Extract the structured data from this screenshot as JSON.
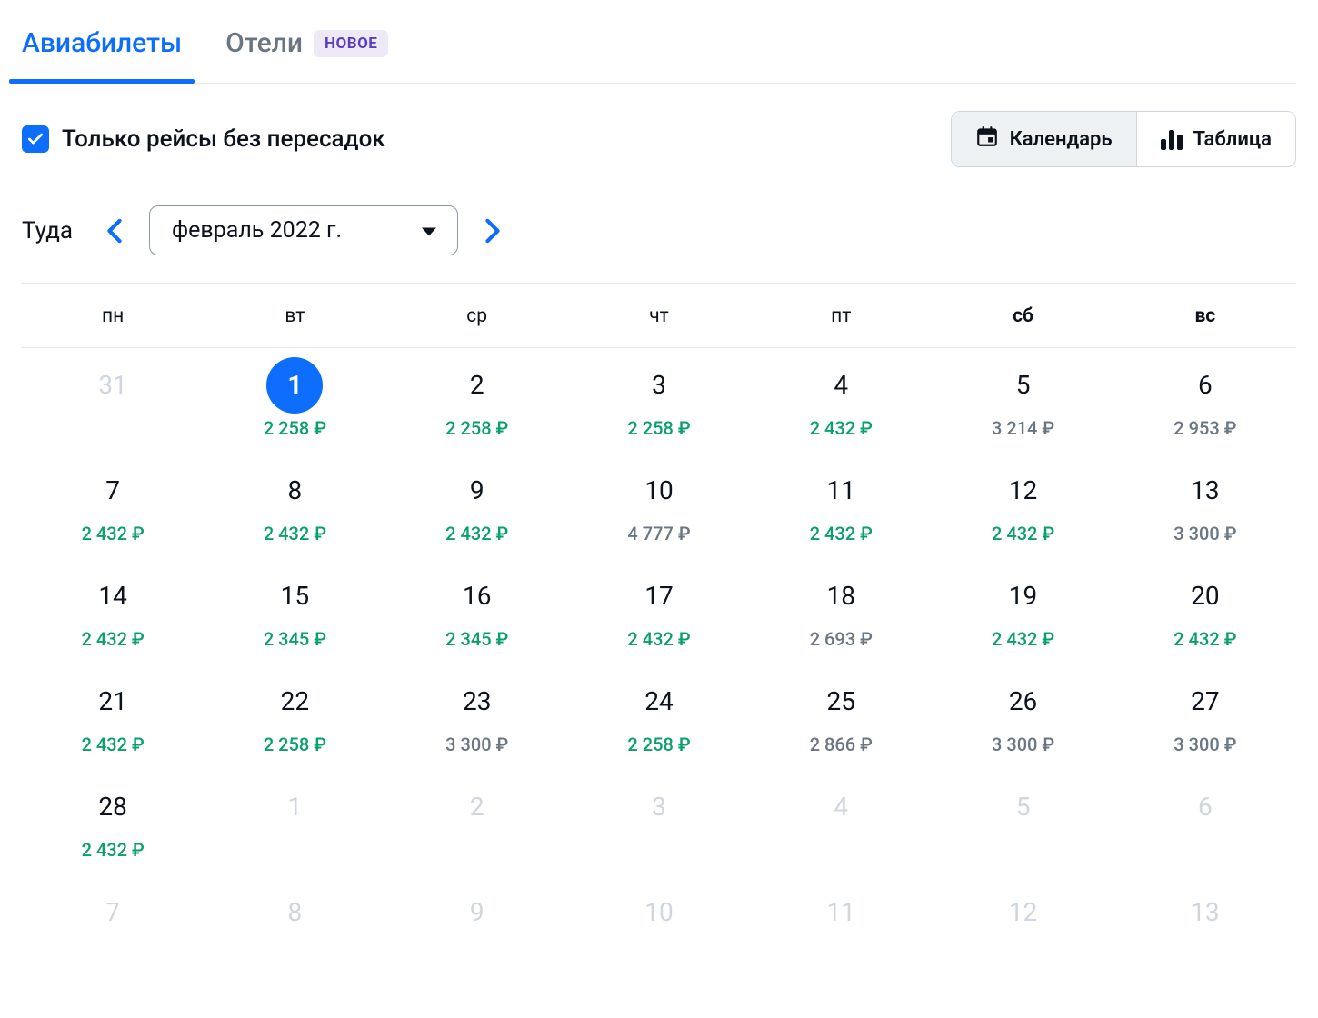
{
  "tabs": {
    "flights": "Авиабилеты",
    "hotels": "Отели",
    "badge": "НОВОЕ"
  },
  "filter": {
    "direct_only_label": "Только рейсы без пересадок"
  },
  "view": {
    "calendar": "Календарь",
    "table": "Таблица"
  },
  "nav": {
    "direction_label": "Туда",
    "month_label": "февраль 2022 г."
  },
  "dow": [
    "пн",
    "вт",
    "ср",
    "чт",
    "пт",
    "сб",
    "вс"
  ],
  "currency": "₽",
  "cells": [
    {
      "day": "31",
      "out": true
    },
    {
      "day": "1",
      "price": "2 258",
      "color": "green",
      "selected": true
    },
    {
      "day": "2",
      "price": "2 258",
      "color": "green"
    },
    {
      "day": "3",
      "price": "2 258",
      "color": "green"
    },
    {
      "day": "4",
      "price": "2 432",
      "color": "green"
    },
    {
      "day": "5",
      "price": "3 214",
      "color": "gray"
    },
    {
      "day": "6",
      "price": "2 953",
      "color": "gray"
    },
    {
      "day": "7",
      "price": "2 432",
      "color": "green"
    },
    {
      "day": "8",
      "price": "2 432",
      "color": "green"
    },
    {
      "day": "9",
      "price": "2 432",
      "color": "green"
    },
    {
      "day": "10",
      "price": "4 777",
      "color": "gray"
    },
    {
      "day": "11",
      "price": "2 432",
      "color": "green"
    },
    {
      "day": "12",
      "price": "2 432",
      "color": "green"
    },
    {
      "day": "13",
      "price": "3 300",
      "color": "gray"
    },
    {
      "day": "14",
      "price": "2 432",
      "color": "green"
    },
    {
      "day": "15",
      "price": "2 345",
      "color": "green"
    },
    {
      "day": "16",
      "price": "2 345",
      "color": "green"
    },
    {
      "day": "17",
      "price": "2 432",
      "color": "green"
    },
    {
      "day": "18",
      "price": "2 693",
      "color": "gray"
    },
    {
      "day": "19",
      "price": "2 432",
      "color": "green"
    },
    {
      "day": "20",
      "price": "2 432",
      "color": "green"
    },
    {
      "day": "21",
      "price": "2 432",
      "color": "green"
    },
    {
      "day": "22",
      "price": "2 258",
      "color": "green"
    },
    {
      "day": "23",
      "price": "3 300",
      "color": "gray"
    },
    {
      "day": "24",
      "price": "2 258",
      "color": "green"
    },
    {
      "day": "25",
      "price": "2 866",
      "color": "gray"
    },
    {
      "day": "26",
      "price": "3 300",
      "color": "gray"
    },
    {
      "day": "27",
      "price": "3 300",
      "color": "gray"
    },
    {
      "day": "28",
      "price": "2 432",
      "color": "green"
    },
    {
      "day": "1",
      "out": true
    },
    {
      "day": "2",
      "out": true
    },
    {
      "day": "3",
      "out": true
    },
    {
      "day": "4",
      "out": true
    },
    {
      "day": "5",
      "out": true
    },
    {
      "day": "6",
      "out": true
    },
    {
      "day": "7",
      "out": true
    },
    {
      "day": "8",
      "out": true
    },
    {
      "day": "9",
      "out": true
    },
    {
      "day": "10",
      "out": true
    },
    {
      "day": "11",
      "out": true
    },
    {
      "day": "12",
      "out": true
    },
    {
      "day": "13",
      "out": true
    }
  ]
}
